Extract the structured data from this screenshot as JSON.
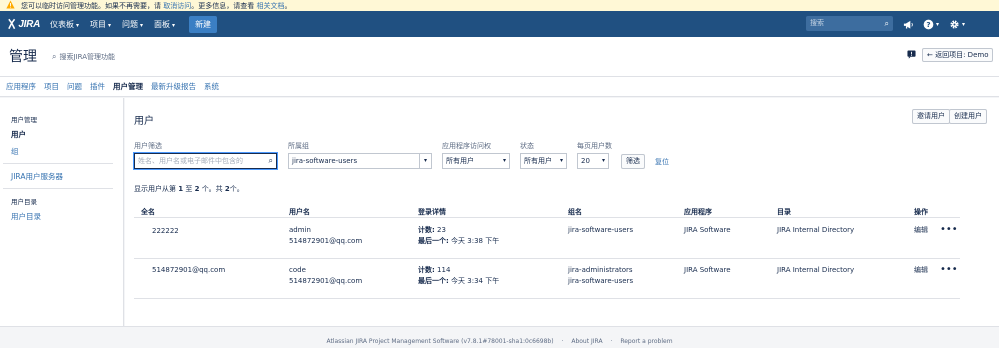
{
  "banner": {
    "text_prefix": "您可以临时访问管理功能。如果不再需要，请",
    "cancel_link": "取消访问",
    "text_middle": "。更多信息，请查看",
    "docs_link": "相关文档",
    "text_suffix": "。",
    "icon": "warning-icon"
  },
  "topnav": {
    "logo_text": "JIRA",
    "menus": [
      "仪表板",
      "项目",
      "问题",
      "面板"
    ],
    "create_label": "新建",
    "search_placeholder": "搜索",
    "icons": [
      "megaphone-icon",
      "help-icon",
      "gear-icon"
    ],
    "bar_color": "#205081"
  },
  "admin": {
    "title": "管理",
    "search_placeholder": "搜索JIRA管理功能",
    "back_label": "← 返回项目: Demo"
  },
  "tabs": [
    "应用程序",
    "项目",
    "问题",
    "插件",
    "用户管理",
    "最新升级报告",
    "系统"
  ],
  "active_tab": "用户管理",
  "sidebar": {
    "section1_heading": "用户管理",
    "items1": [
      "用户",
      "组"
    ],
    "item_jira_server": "JIRA用户服务器",
    "section2_heading": "用户目录",
    "items2": [
      "用户目录"
    ]
  },
  "main": {
    "heading": "用户",
    "invite_button": "邀请用户",
    "create_button": "创建用户",
    "filters": {
      "user_filter_label": "用户筛选",
      "user_filter_placeholder": "姓名、用户名或电子邮件中包含的",
      "group_label": "所属组",
      "group_value": "jira-software-users",
      "app_access_label": "应用程序访问权",
      "app_access_value": "所有用户",
      "status_label": "状态",
      "status_value": "所有用户",
      "per_page_label": "每页用户数",
      "per_page_value": "20",
      "filter_button": "筛选",
      "reset_link": "复位"
    },
    "summary": {
      "prefix": "显示用户从第",
      "from": "1",
      "to_word": "至",
      "to": "2",
      "total_word": "个。共",
      "total": "2",
      "suffix": "个。"
    },
    "table": {
      "columns": [
        "全名",
        "用户名",
        "登录详情",
        "组名",
        "应用程序",
        "目录",
        "操作"
      ],
      "rows": [
        {
          "full_name": "222222",
          "username": "admin",
          "email": "514872901@qq.com",
          "count_label": "计数:",
          "count": "23",
          "last_label": "最后一个:",
          "last": "今天 3:38 下午",
          "groups": [
            "jira-software-users"
          ],
          "application": "JIRA Software",
          "directory": "JIRA Internal Directory",
          "edit": "编辑",
          "more": "•••"
        },
        {
          "full_name": "514872901@qq.com",
          "username": "code",
          "email": "514872901@qq.com",
          "count_label": "计数:",
          "count": "114",
          "last_label": "最后一个:",
          "last": "今天 3:34 下午",
          "groups": [
            "jira-administrators",
            "jira-software-users"
          ],
          "application": "JIRA Software",
          "directory": "JIRA Internal Directory",
          "edit": "编辑",
          "more": "•••"
        }
      ]
    }
  },
  "footer": {
    "product": "Atlassian JIRA Project Management Software (v7.8.1#78001-sha1:0c6698b)",
    "about": "About JIRA",
    "report": "Report a problem"
  }
}
